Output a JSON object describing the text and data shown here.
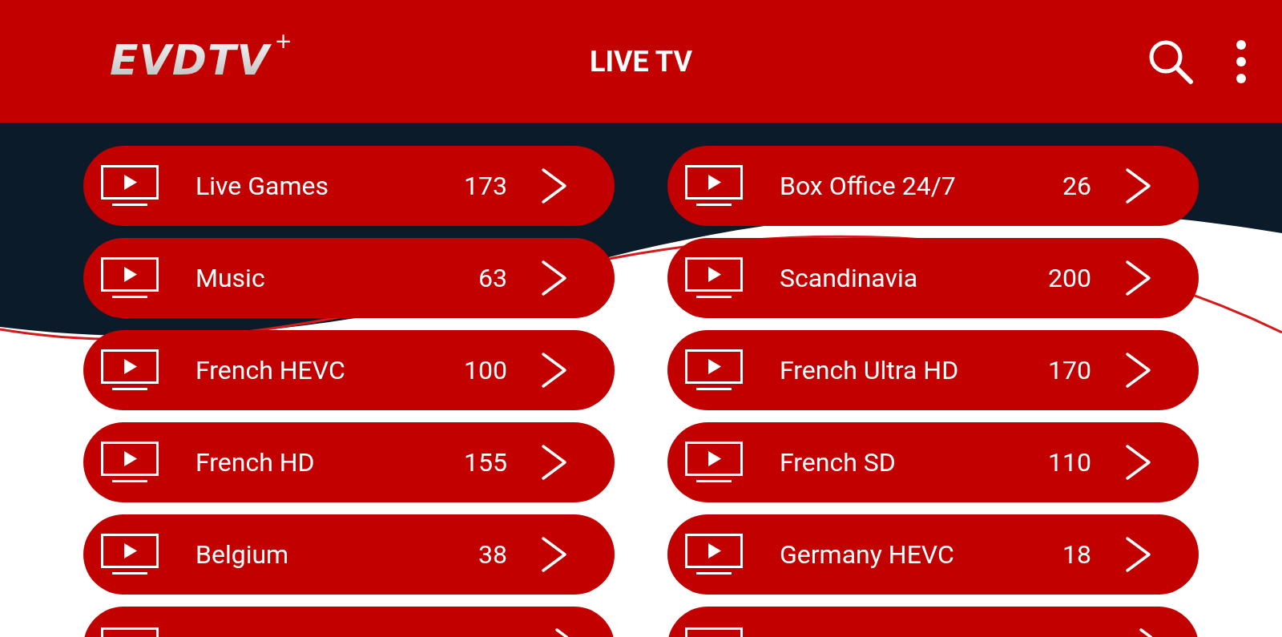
{
  "header": {
    "logo": "EVDTV",
    "logo_mark": "+",
    "title": "LIVE TV"
  },
  "categories": [
    {
      "name": "Live Games",
      "count": "173"
    },
    {
      "name": "Box Office 24/7",
      "count": "26"
    },
    {
      "name": "Music",
      "count": "63"
    },
    {
      "name": "Scandinavia",
      "count": "200"
    },
    {
      "name": "French HEVC",
      "count": "100"
    },
    {
      "name": "French Ultra HD",
      "count": "170"
    },
    {
      "name": "French HD",
      "count": "155"
    },
    {
      "name": "French SD",
      "count": "110"
    },
    {
      "name": "Belgium",
      "count": "38"
    },
    {
      "name": "Germany HEVC",
      "count": "18"
    }
  ],
  "more_below": true
}
